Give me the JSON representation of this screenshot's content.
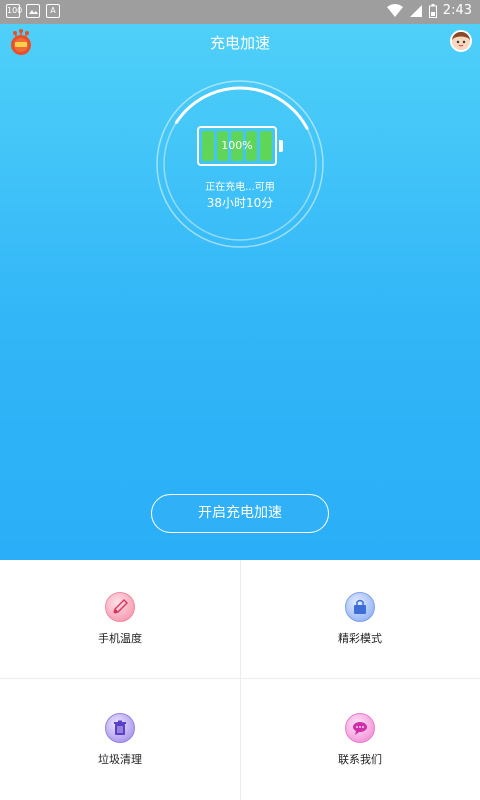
{
  "status_bar": {
    "time": "2:43",
    "left_icons": [
      "100",
      "image-icon",
      "A"
    ]
  },
  "header": {
    "title": "充电加速"
  },
  "battery": {
    "percent_label": "100%",
    "charge_level": 1.0,
    "status_text": "正在充电...可用",
    "remaining_time": "38小时10分",
    "ring_progress": 0.33
  },
  "boost_button": {
    "label": "开启充电加速"
  },
  "features": [
    {
      "label": "手机温度",
      "icon": "thermometer-icon",
      "color": "#f48aa3"
    },
    {
      "label": "精彩模式",
      "icon": "bag-icon",
      "color": "#7fa6f0"
    },
    {
      "label": "垃圾清理",
      "icon": "trash-icon",
      "color": "#9a82e6"
    },
    {
      "label": "联系我们",
      "icon": "chat-bubble-icon",
      "color": "#f07fd0"
    }
  ],
  "colors": {
    "hero_top": "#4fd0f9",
    "hero_bottom": "#2aaef7",
    "battery_cell": "#5fd65a"
  }
}
